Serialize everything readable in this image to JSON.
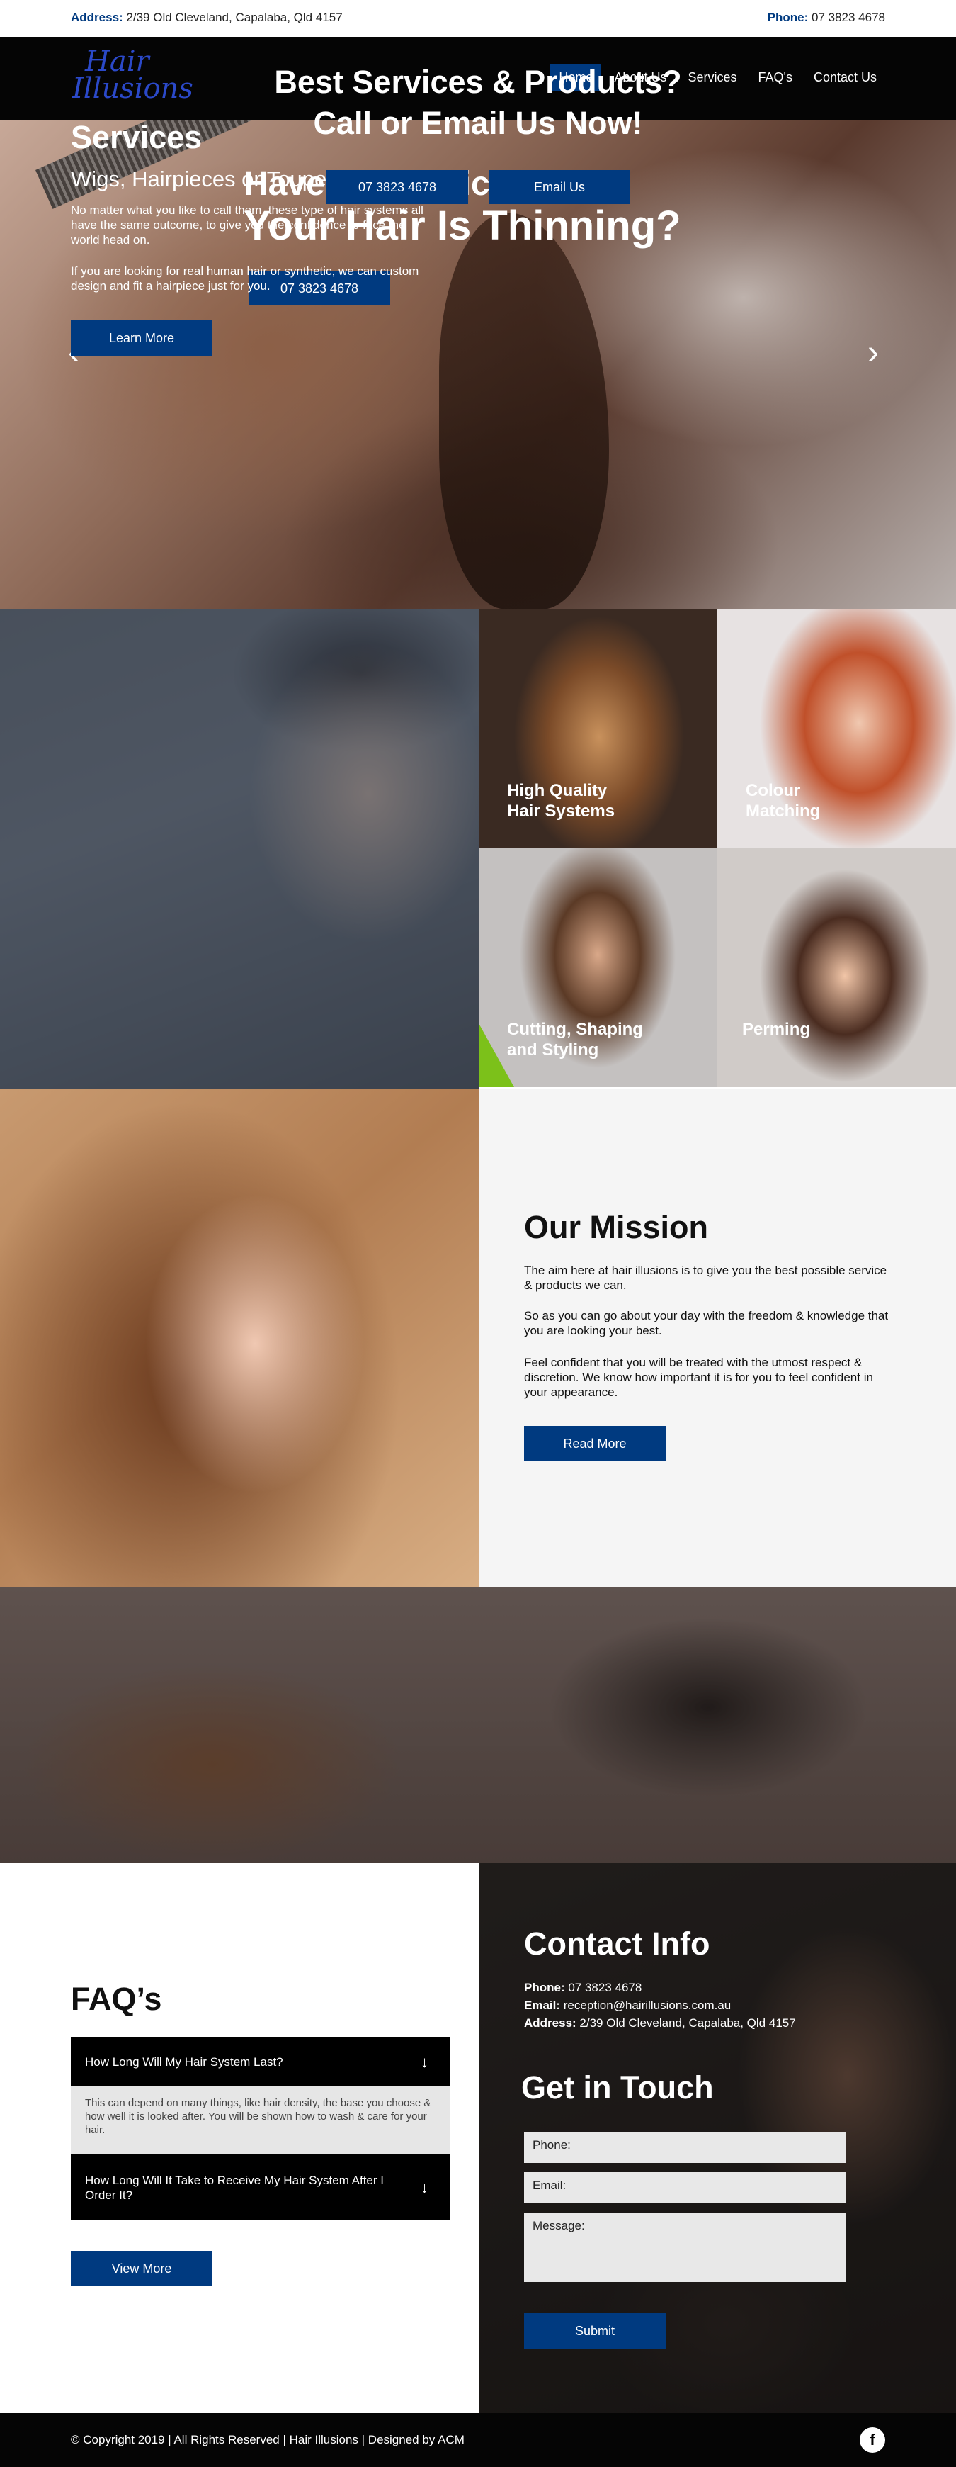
{
  "topbar": {
    "address_label": "Address:",
    "address": "2/39 Old Cleveland, Capalaba, Qld 4157",
    "phone_label": "Phone:",
    "phone": "07 3823 4678"
  },
  "brand": {
    "logo_line1": "Hair",
    "logo_line2": "Illusions"
  },
  "nav": {
    "items": [
      {
        "label": "Home",
        "active": true
      },
      {
        "label": "About Us"
      },
      {
        "label": "Services"
      },
      {
        "label": "FAQ's"
      },
      {
        "label": "Contact Us"
      }
    ]
  },
  "hero": {
    "title_line1": "Have You Noticed",
    "title_line2": "Your Hair Is Thinning?",
    "button": "07 3823 4678",
    "prev_icon": "chevron-left-icon",
    "next_icon": "chevron-right-icon"
  },
  "services": {
    "title": "Services",
    "subtitle": "Wigs, Hairpieces or Toupees",
    "p1": "No matter what you like to call them, these type of hair systems all have the same outcome, to give you the confidence to face the world head on.",
    "p2": "If you are looking for real human hair or synthetic, we can custom design and fit a hairpiece just for you.",
    "button": "Learn More",
    "tiles": [
      {
        "line1": "High Quality",
        "line2": "Hair Systems"
      },
      {
        "line1": "Colour",
        "line2": "Matching"
      },
      {
        "line1": "Cutting, Shaping",
        "line2": "and Styling"
      },
      {
        "line1": "Perming",
        "line2": ""
      }
    ]
  },
  "mission": {
    "title": "Our Mission",
    "p1": "The aim here at hair illusions is to give you the best possible service & products we can.",
    "p2": "So as you can go about your day with the freedom & knowledge that you are looking your best.",
    "p3": "Feel confident that you will be treated with the utmost respect & discretion. We know how important it is for you to feel confident in your appearance.",
    "button": "Read More"
  },
  "cta": {
    "line1": "Best Services & Products?",
    "line2": "Call or Email Us Now!",
    "phone_button": "07 3823 4678",
    "email_button": "Email Us"
  },
  "faq": {
    "title": "FAQ’s",
    "items": [
      {
        "question": "How Long Will My Hair System Last?",
        "answer": "This can depend on many things, like hair density, the base you choose & how well it is looked after. You will be shown how to wash & care for your hair."
      },
      {
        "question": "How Long Will It Take to Receive My Hair System After I Order It?",
        "answer": ""
      }
    ],
    "toggle_icon": "arrow-down-icon",
    "button": "View More"
  },
  "contact": {
    "title": "Contact Info",
    "phone_label": "Phone:",
    "phone": "07 3823 4678",
    "email_label": "Email:",
    "email": "reception@hairillusions.com.au",
    "address_label": "Address:",
    "address": "2/39 Old Cleveland, Capalaba, Qld 4157",
    "form_title": "Get in Touch",
    "phone_placeholder": "Phone:",
    "email_placeholder": "Email:",
    "message_placeholder": "Message:",
    "submit": "Submit"
  },
  "footer": {
    "copyright": "© Copyright 2019 | All Rights Reserved | Hair Illusions | Designed by ACM",
    "social_icon": "facebook-icon"
  }
}
